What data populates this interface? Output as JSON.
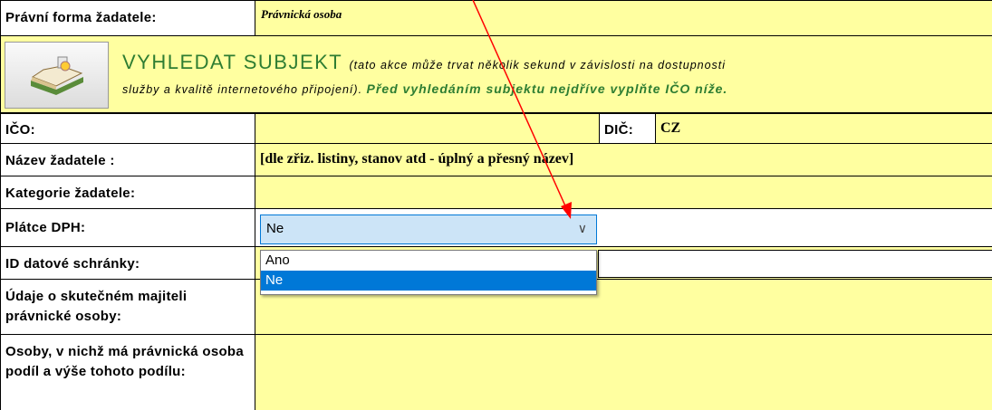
{
  "form": {
    "pravni_forma_label": "Právní forma žadatele:",
    "pravni_forma_value": "Právnická osoba",
    "search": {
      "title": "VYHLEDAT SUBJEKT",
      "note_1": "(tato akce může trvat několik sekund v závislosti na dostupnosti",
      "note_2": "služby a kvalitě internetového připojení).",
      "note_green": "Před vyhledáním subjektu nejdříve vyplňte IČO níže."
    },
    "ico_label": "IČO:",
    "dic_label": "DIČ:",
    "dic_value": "CZ",
    "nazev_label": "Název žadatele :",
    "nazev_value": "[dle zřiz. listiny, stanov atd - úplný a přesný název]",
    "kategorie_label": "Kategorie žadatele:",
    "platce_label": "Plátce DPH:",
    "platce_value": "Ne",
    "platce_options": [
      "Ano",
      "Ne"
    ],
    "datovka_label": "ID datové schránky:",
    "majitel_label": "Údaje o skutečném majiteli právnické osoby:",
    "osoby_label": "Osoby, v nichž má právnická osoba podíl a výše tohoto podílu:"
  },
  "colors": {
    "field": "#ffffa0",
    "green_text": "#2e7d32",
    "selected": "#0078d7",
    "arrow": "#ff0000"
  }
}
